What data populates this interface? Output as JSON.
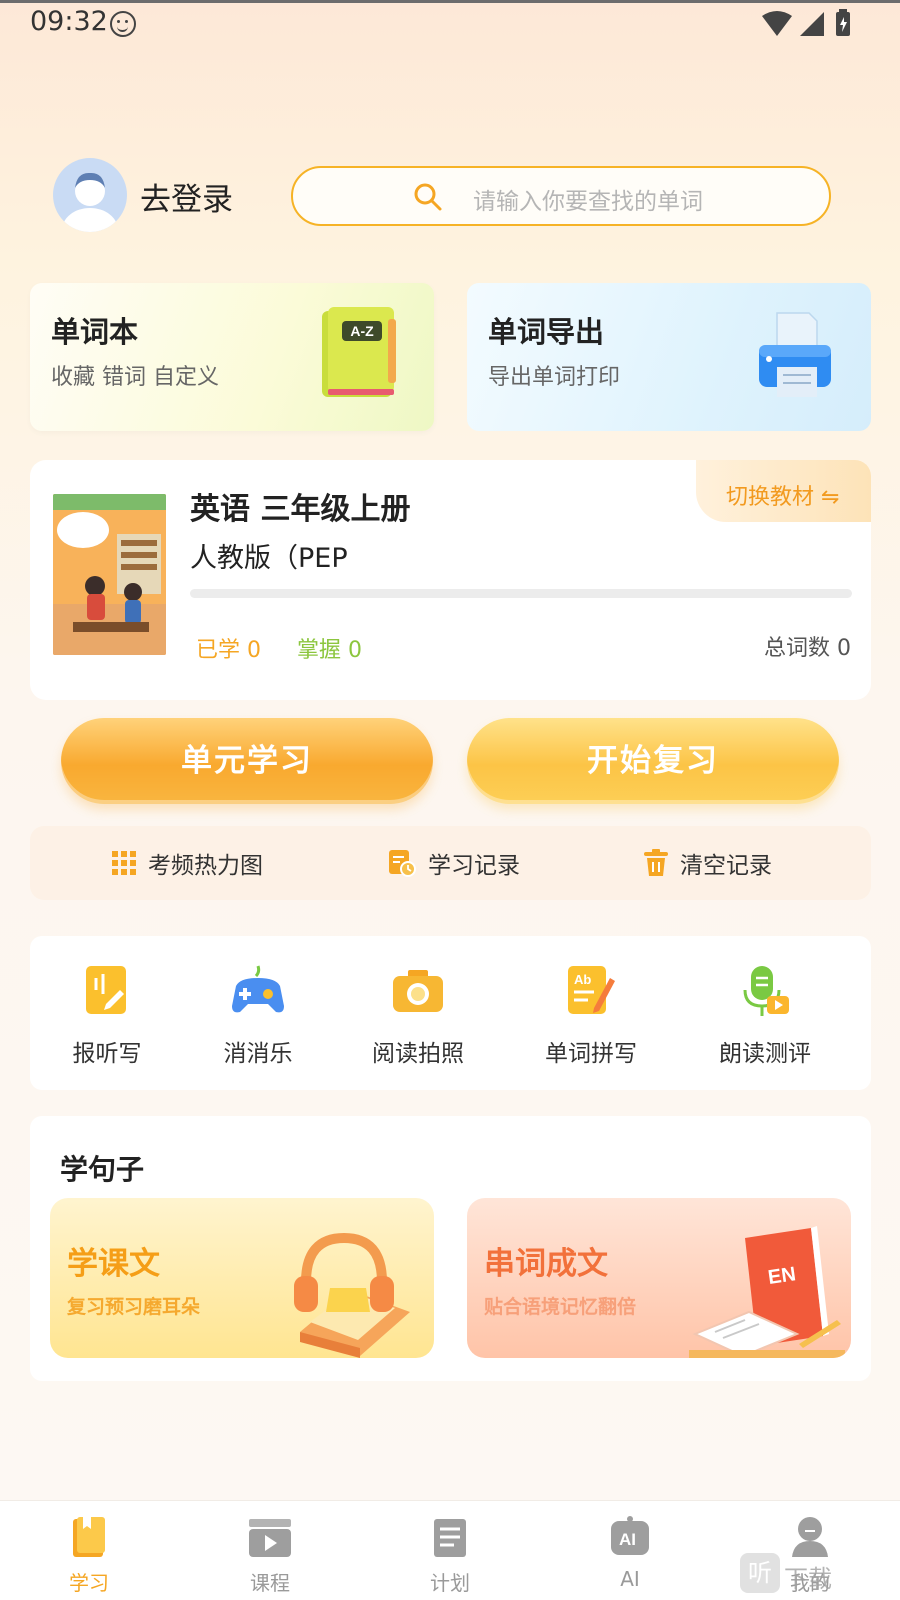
{
  "status_bar": {
    "time": "09:32"
  },
  "header": {
    "login_label": "去登录",
    "search_placeholder": "请输入你要查找的单词"
  },
  "cards": {
    "wordbook": {
      "title": "单词本",
      "subtitle": "收藏 错词 自定义",
      "icon": "a-z-book-icon"
    },
    "export": {
      "title": "单词导出",
      "subtitle": "导出单词打印",
      "icon": "printer-icon"
    }
  },
  "textbook": {
    "switch_label": "切换教材 ⇋",
    "title": "英语 三年级上册",
    "edition": "人教版（PEP",
    "progress": 0,
    "learned_text": "已学  0",
    "mastered_text": "掌握  0",
    "total_text": "总词数 0"
  },
  "actions": {
    "unit_study": "单元学习",
    "start_review": "开始复习"
  },
  "tools": [
    {
      "label": "考频热力图",
      "icon": "grid-icon"
    },
    {
      "label": "学习记录",
      "icon": "record-icon"
    },
    {
      "label": "清空记录",
      "icon": "trash-icon"
    }
  ],
  "features": [
    {
      "label": "报听写",
      "icon": "dictation-icon"
    },
    {
      "label": "消消乐",
      "icon": "gamepad-icon"
    },
    {
      "label": "阅读拍照",
      "icon": "camera-icon"
    },
    {
      "label": "单词拼写",
      "icon": "spelling-icon"
    },
    {
      "label": "朗读测评",
      "icon": "microphone-icon"
    }
  ],
  "sentences": {
    "section_title": "学句子",
    "lesson": {
      "title": "学课文",
      "subtitle": "复习预习磨耳朵"
    },
    "combine": {
      "title": "串词成文",
      "subtitle": "贴合语境记忆翻倍"
    }
  },
  "bottom_nav": [
    {
      "label": "学习",
      "icon": "book-icon",
      "active": true
    },
    {
      "label": "课程",
      "icon": "video-icon",
      "active": false
    },
    {
      "label": "计划",
      "icon": "plan-icon",
      "active": false
    },
    {
      "label": "AI",
      "icon": "ai-icon",
      "active": false
    },
    {
      "label": "我的",
      "icon": "user-icon",
      "active": false
    }
  ],
  "watermark": {
    "logo": "听",
    "text": "下载"
  },
  "colors": {
    "accent": "#f5a623",
    "green": "#8cc63e",
    "coral": "#f2713b"
  }
}
